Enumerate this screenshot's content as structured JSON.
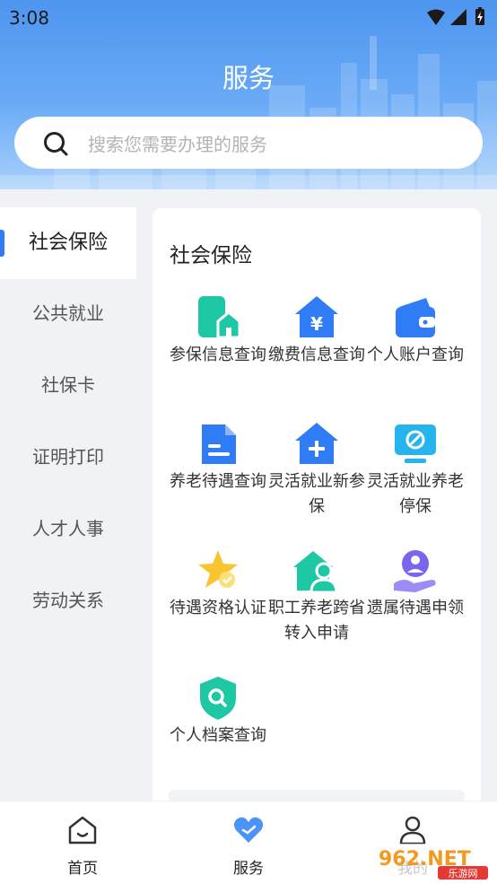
{
  "status_bar": {
    "time": "3:08"
  },
  "header": {
    "title": "服务",
    "search_placeholder": "搜索您需要办理的服务"
  },
  "sidebar": {
    "items": [
      {
        "label": "社会保险",
        "active": true
      },
      {
        "label": "公共就业",
        "active": false
      },
      {
        "label": "社保卡",
        "active": false
      },
      {
        "label": "证明打印",
        "active": false
      },
      {
        "label": "人才人事",
        "active": false
      },
      {
        "label": "劳动关系",
        "active": false
      }
    ]
  },
  "content": {
    "section_title": "社会保险",
    "services": [
      {
        "label": "参保信息查询",
        "icon": "phone-house-icon",
        "color": "#1fc8a4"
      },
      {
        "label": "缴费信息查询",
        "icon": "yen-house-icon",
        "color": "#2f7cf6"
      },
      {
        "label": "个人账户查询",
        "icon": "wallet-icon",
        "color": "#2f7cf6"
      },
      {
        "label": "养老待遇查询",
        "icon": "document-icon",
        "color": "#2f7cf6"
      },
      {
        "label": "灵活就业新参保",
        "icon": "plus-house-icon",
        "color": "#2f7cf6"
      },
      {
        "label": "灵活就业养老停保",
        "icon": "monitor-stop-icon",
        "color": "#26b4ee"
      },
      {
        "label": "待遇资格认证",
        "icon": "star-badge-icon",
        "color": "#f8c530"
      },
      {
        "label": "职工养老跨省转入申请",
        "icon": "house-person-icon",
        "color": "#1fc8a4"
      },
      {
        "label": "遗属待遇申领",
        "icon": "hand-person-icon",
        "color": "#7b64f0"
      },
      {
        "label": "个人档案查询",
        "icon": "shield-search-icon",
        "color": "#1fc8a4"
      }
    ]
  },
  "tabbar": {
    "tabs": [
      {
        "label": "首页",
        "icon": "home-icon"
      },
      {
        "label": "服务",
        "icon": "service-heart-icon"
      },
      {
        "label": "我的",
        "icon": "person-icon"
      }
    ]
  },
  "watermark": {
    "text": "962.NET",
    "sub": "乐游网"
  },
  "colors": {
    "accent": "#2f7cf6",
    "teal": "#1fc8a4",
    "purple": "#7b64f0",
    "yellow": "#f8c530"
  }
}
